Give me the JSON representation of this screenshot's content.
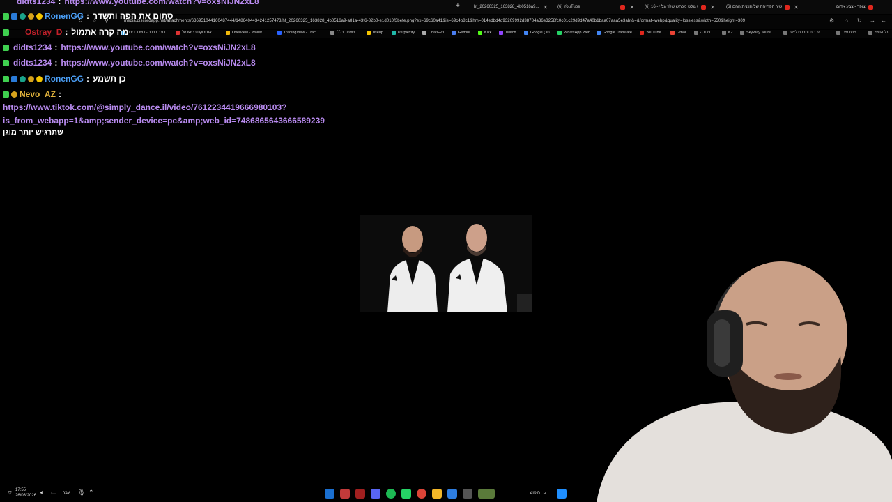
{
  "browser": {
    "tabs": [
      {
        "label": "hf_20260325_163828_4b0516a9...",
        "active": true
      },
      {
        "label": "(6) YouTube",
        "active": false
      },
      {
        "label": "(6) גולש מכחש שלך עליי - 16+",
        "active": false
      },
      {
        "label": "(6) שיר הפתיחה של תכנית החם",
        "active": false
      },
      {
        "label": "צופר - צבע אדום",
        "active": false
      }
    ],
    "new_tab_label": "+",
    "url": "media.discordapp.net/attachments/636951044160487444/1486404434241257473/hf_20260325_163828_4b0516a9-a81a-43f6-82b0-e1d010f3befe.png?ex=69c60a41&is=69c4b8c1&hm=014edbd4d93209992d38784a36e3258fc0c01c29d9d47a40b1baa07aaa5e3abf&=&format=webp&quality=lossless&width=550&height=309",
    "bookmarks": [
      "דורך ברבר - דשרד דירה",
      "אנטרוקטיבי ישראל",
      "Overview · Wallet",
      "TradingView - Trac",
      "שערוך כללי",
      "riseup",
      "Perplexity",
      "ChatGPT",
      "Gemini",
      "Kick",
      "Twitch",
      "Google (תר",
      "WhatsApp Web",
      "Google Translate",
      "YouTube",
      "Gmail",
      "עבודה",
      "KZ",
      "SkyWay Tours",
      "פדרות ותכנים לצפי...",
      "מועדפים",
      "כל הסימ"
    ]
  },
  "chat": {
    "messages": [
      {
        "user": "didts1234",
        "text": "https://www.youtube.com/watch?v=oxsNiJN2xL8",
        "type": "link",
        "name_color": "purple"
      },
      {
        "user": "RonenGG",
        "text": "סתום את הפה ותשדר",
        "type": "text",
        "name_color": "blue"
      },
      {
        "user": "Ostray_D",
        "text": "מה קרה אתמול",
        "type": "text",
        "name_color": "red"
      },
      {
        "user": "didts1234",
        "text": "https://www.youtube.com/watch?v=oxsNiJN2xL8",
        "type": "link",
        "name_color": "purple"
      },
      {
        "user": "didts1234",
        "text": "https://www.youtube.com/watch?v=oxsNiJN2xL8",
        "type": "link",
        "name_color": "purple"
      },
      {
        "user": "RonenGG",
        "text": "כן תשמע",
        "type": "text",
        "name_color": "blue"
      },
      {
        "user": "Nevo_AZ",
        "text": "",
        "type": "text",
        "name_color": "gold"
      }
    ],
    "long_link_line1": "https://www.tiktok.com/@simply_dance.il/video/7612234419666980103?",
    "long_link_line2": "is_from_webapp=1&amp;sender_device=pc&amp;web_id=7486865643666589239",
    "last_text": "שתרגיש יותר מוגן"
  },
  "taskbar": {
    "time": "17:55",
    "date": "26/03/2026",
    "language": "עבר",
    "search_label": "חיפוש"
  },
  "colors": {
    "link": "#b98bf0",
    "blue_name": "#4b9ef5",
    "gold_name": "#e2b33c",
    "red_name": "#c4202a",
    "badge_green": "#3fcf4f"
  }
}
